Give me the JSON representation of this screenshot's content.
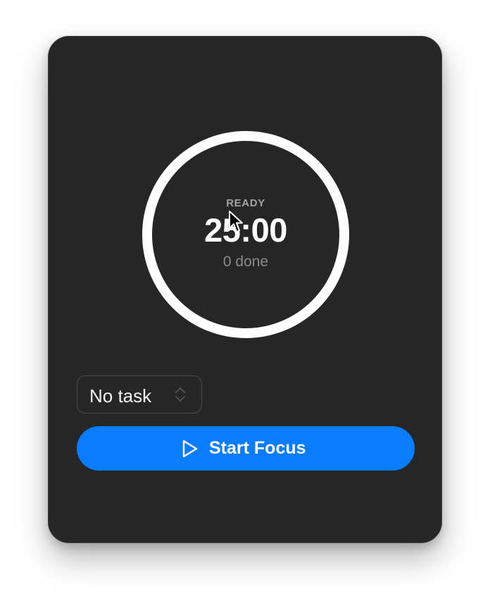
{
  "timer": {
    "state": "READY",
    "time": "25:00",
    "done": "0 done",
    "progress": 0
  },
  "task_select": {
    "selected": "No task"
  },
  "start_button": {
    "label": "Start Focus"
  },
  "icons": {
    "start": "play-icon",
    "select": "chevron-up-down-icon",
    "pointer": "mouse-pointer-icon"
  },
  "colors": {
    "window_bg": "#262626",
    "ring": "#ffffff",
    "accent": "#0a7cff"
  }
}
